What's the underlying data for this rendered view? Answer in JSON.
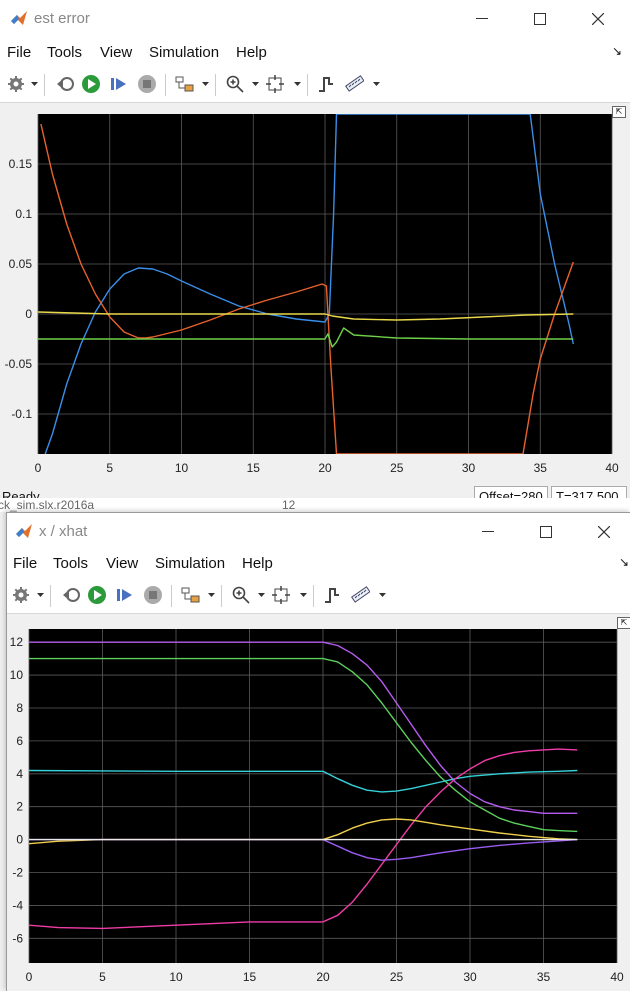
{
  "window1": {
    "title": "est error",
    "menu": [
      "File",
      "Tools",
      "View",
      "Simulation",
      "Help"
    ],
    "status": {
      "ready": "Ready",
      "offset": "Offset=280",
      "time": "T=317.500"
    },
    "chart_data": {
      "type": "line",
      "xlim": [
        0,
        40
      ],
      "ylim": [
        -0.14,
        0.2
      ],
      "xticks": [
        0,
        5,
        10,
        15,
        20,
        25,
        30,
        35,
        40
      ],
      "xtick_labels": [
        "0",
        "5",
        "10",
        "15",
        "20",
        "25",
        "30",
        "35",
        "40"
      ],
      "yticks": [
        0.15,
        0.1,
        0.05,
        0,
        -0.05,
        -0.1
      ],
      "ytick_labels": [
        "0.15",
        "0.1",
        "0.05",
        "0",
        "-0.05",
        "-0.1"
      ],
      "grid": true,
      "series": [
        {
          "color": "#3b8ee8",
          "x": [
            0.5,
            1,
            2,
            3,
            4,
            5,
            6,
            7,
            8,
            9,
            10,
            12,
            14,
            16,
            18,
            20,
            20.3,
            20.6,
            20.8,
            34.3,
            35,
            36,
            37,
            37.3
          ],
          "y": [
            -0.14,
            -0.12,
            -0.07,
            -0.03,
            0.002,
            0.025,
            0.04,
            0.046,
            0.045,
            0.04,
            0.033,
            0.02,
            0.008,
            0.0,
            -0.005,
            -0.008,
            0.0,
            0.1,
            0.2,
            0.2,
            0.12,
            0.05,
            -0.01,
            -0.03
          ]
        },
        {
          "color": "#e8622c",
          "x": [
            0.2,
            1,
            2,
            3,
            4,
            5,
            6,
            7,
            7.5,
            8,
            10,
            12,
            14,
            16,
            18,
            19.8,
            20.1,
            20.4,
            20.8,
            33.8,
            34.5,
            35,
            36,
            37.3
          ],
          "y": [
            0.19,
            0.14,
            0.09,
            0.05,
            0.02,
            -0.003,
            -0.018,
            -0.024,
            -0.024,
            -0.023,
            -0.016,
            -0.006,
            0.005,
            0.014,
            0.022,
            0.03,
            0.028,
            -0.05,
            -0.14,
            -0.14,
            -0.08,
            -0.045,
            0.0,
            0.052
          ]
        },
        {
          "color": "#e8d84a",
          "x": [
            0,
            5,
            10,
            15,
            20,
            20.5,
            21,
            22,
            25,
            28,
            31,
            34,
            37.3
          ],
          "y": [
            0.002,
            0.0,
            0.0,
            0.0,
            0.0,
            -0.002,
            -0.003,
            -0.005,
            -0.006,
            -0.005,
            -0.003,
            -0.001,
            0.0
          ]
        },
        {
          "color": "#6fd04a",
          "x": [
            0,
            5,
            10,
            15,
            20,
            20.2,
            20.5,
            20.8,
            21.3,
            22,
            25,
            30,
            35,
            37.3
          ],
          "y": [
            -0.025,
            -0.025,
            -0.025,
            -0.025,
            -0.025,
            -0.02,
            -0.033,
            -0.028,
            -0.014,
            -0.021,
            -0.024,
            -0.025,
            -0.025,
            -0.025
          ]
        }
      ]
    }
  },
  "background_window": {
    "left_text": "ck_sim.slx.r2016a",
    "right_text": "12"
  },
  "window2": {
    "title": "x / xhat",
    "menu": [
      "File",
      "Tools",
      "View",
      "Simulation",
      "Help"
    ],
    "chart_data": {
      "type": "line",
      "xlim": [
        0,
        40
      ],
      "ylim": [
        -7.5,
        12.8
      ],
      "xticks": [
        0,
        5,
        10,
        15,
        20,
        25,
        30,
        35,
        40
      ],
      "xtick_labels": [
        "0",
        "5",
        "10",
        "15",
        "20",
        "25",
        "30",
        "35",
        "40"
      ],
      "yticks": [
        12,
        10,
        8,
        6,
        4,
        2,
        0,
        -2,
        -4,
        -6
      ],
      "ytick_labels": [
        "12",
        "10",
        "8",
        "6",
        "4",
        "2",
        "0",
        "-2",
        "-4",
        "-6"
      ],
      "grid": true,
      "series": [
        {
          "color": "#b65cf0",
          "x": [
            0,
            10,
            20,
            21,
            22,
            23,
            24,
            25,
            26,
            27,
            28,
            29,
            30,
            31,
            32,
            33,
            34,
            35,
            36,
            37.3
          ],
          "y": [
            12,
            12,
            12,
            11.8,
            11.3,
            10.6,
            9.6,
            8.3,
            7.0,
            5.7,
            4.5,
            3.5,
            2.8,
            2.3,
            2.0,
            1.8,
            1.7,
            1.6,
            1.6,
            1.6
          ]
        },
        {
          "color": "#5cd05c",
          "x": [
            0,
            10,
            20,
            21,
            22,
            23,
            24,
            25,
            26,
            27,
            28,
            29,
            30,
            31,
            32,
            33,
            34,
            35,
            36,
            37.3
          ],
          "y": [
            11,
            11,
            11,
            10.8,
            10.2,
            9.4,
            8.3,
            7.1,
            5.9,
            4.8,
            3.8,
            3.0,
            2.3,
            1.8,
            1.3,
            1.0,
            0.8,
            0.6,
            0.55,
            0.5
          ]
        },
        {
          "color": "#35d0d8",
          "x": [
            0,
            10,
            20,
            21,
            22,
            23,
            24,
            25,
            26,
            27,
            28,
            29,
            30,
            32,
            34,
            36,
            37.3
          ],
          "y": [
            4.2,
            4.15,
            4.15,
            3.7,
            3.3,
            3.0,
            2.9,
            2.95,
            3.1,
            3.3,
            3.5,
            3.7,
            3.85,
            4.0,
            4.1,
            4.15,
            4.2
          ]
        },
        {
          "color": "#f03ca8",
          "x": [
            0,
            2,
            5,
            10,
            15,
            20,
            21,
            22,
            23,
            24,
            25,
            26,
            27,
            28,
            29,
            30,
            31,
            32,
            33,
            34,
            35,
            36,
            37.3
          ],
          "y": [
            -5.2,
            -5.35,
            -5.4,
            -5.2,
            -5.0,
            -5.0,
            -4.6,
            -3.8,
            -2.7,
            -1.5,
            -0.3,
            0.9,
            2.0,
            2.9,
            3.7,
            4.3,
            4.8,
            5.1,
            5.3,
            5.4,
            5.45,
            5.5,
            5.45
          ]
        },
        {
          "color": "#f0d04a",
          "x": [
            0,
            2,
            5,
            10,
            15,
            20,
            21,
            22,
            23,
            24,
            25,
            26,
            27,
            28,
            30,
            32,
            34,
            36,
            37.3
          ],
          "y": [
            -0.25,
            -0.1,
            0.0,
            0.0,
            0.0,
            0.0,
            0.3,
            0.7,
            1.0,
            1.2,
            1.25,
            1.2,
            1.05,
            0.9,
            0.65,
            0.4,
            0.2,
            0.05,
            0.0
          ]
        },
        {
          "color": "#9a5cf0",
          "x": [
            0,
            5,
            10,
            15,
            20,
            21,
            22,
            23,
            24,
            25,
            26,
            27,
            28,
            30,
            32,
            34,
            36,
            37.3
          ],
          "y": [
            0.0,
            0.0,
            0.0,
            0.0,
            0.0,
            -0.4,
            -0.8,
            -1.1,
            -1.25,
            -1.2,
            -1.1,
            -0.95,
            -0.8,
            -0.55,
            -0.35,
            -0.2,
            -0.08,
            0.0
          ]
        },
        {
          "color": "#e8e8e8",
          "x": [
            0,
            10,
            20,
            30,
            37.3
          ],
          "y": [
            0.0,
            0.0,
            0.0,
            0.0,
            0.0
          ]
        }
      ]
    }
  }
}
